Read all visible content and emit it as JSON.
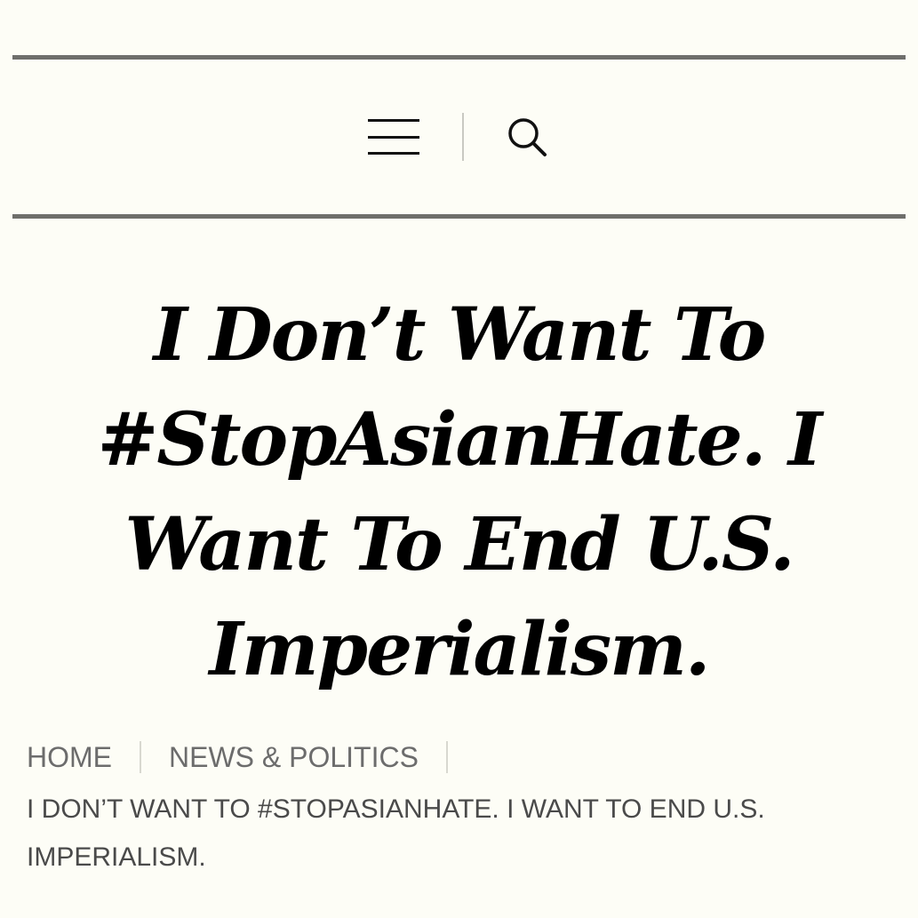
{
  "header": {
    "menu_icon": "hamburger-menu-icon",
    "search_icon": "search-icon"
  },
  "article": {
    "title": "I Don’t Want To #StopAsianHate. I Want To End U.S. Imperialism."
  },
  "breadcrumb": {
    "home_label": "HOME",
    "category_label": "NEWS & POLITICS",
    "current_label": "I DON’T WANT TO #STOPASIANHATE. I WANT TO END U.S. IMPERIALISM."
  },
  "colors": {
    "background": "#fdfdf6",
    "rule": "#6f6f6c",
    "title": "#000000",
    "breadcrumb_link": "#6c6c6c",
    "breadcrumb_current": "#4a4a4a"
  }
}
